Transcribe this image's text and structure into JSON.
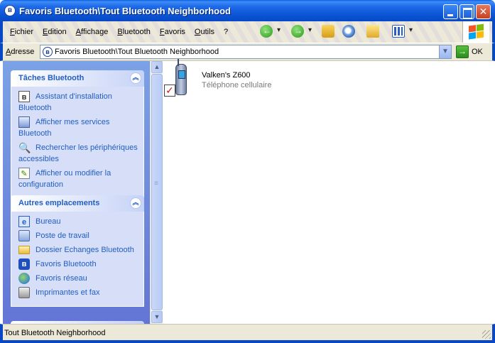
{
  "window": {
    "title": "Favoris Bluetooth\\Tout Bluetooth Neighborhood",
    "app_icon": "bluetooth-icon"
  },
  "menu": {
    "items": [
      "Fichier",
      "Edition",
      "Affichage",
      "Bluetooth",
      "Favoris",
      "Outils",
      "?"
    ]
  },
  "toolbar": {
    "icons": [
      "back-arrow-icon",
      "forward-arrow-icon",
      "up-folder-icon",
      "search-icon",
      "folders-icon",
      "views-icon"
    ]
  },
  "address": {
    "label": "Adresse",
    "value": "Favoris Bluetooth\\Tout Bluetooth Neighborhood",
    "go_label": "OK"
  },
  "tasks_panel": {
    "title": "Tâches Bluetooth",
    "items": [
      {
        "label": "Assistant d'installation Bluetooth",
        "icon": "wizard-icon"
      },
      {
        "label": "Afficher mes services Bluetooth",
        "icon": "services-icon"
      },
      {
        "label": "Rechercher les périphériques accessibles",
        "icon": "search-devices-icon"
      },
      {
        "label": "Afficher ou modifier la configuration",
        "icon": "configuration-icon"
      }
    ]
  },
  "places_panel": {
    "title": "Autres emplacements",
    "items": [
      {
        "label": "Bureau",
        "icon": "desktop-icon"
      },
      {
        "label": "Poste de travail",
        "icon": "my-computer-icon"
      },
      {
        "label": "Dossier Echanges Bluetooth",
        "icon": "folder-icon"
      },
      {
        "label": "Favoris Bluetooth",
        "icon": "bluetooth-icon"
      },
      {
        "label": "Favoris réseau",
        "icon": "network-icon"
      },
      {
        "label": "Imprimantes et fax",
        "icon": "printer-icon"
      }
    ]
  },
  "content": {
    "devices": [
      {
        "name": "Valken's Z600",
        "type": "Téléphone cellulaire",
        "icon": "mobile-phone-icon",
        "checked": true
      }
    ]
  },
  "status": {
    "text": "Tout Bluetooth Neighborhood"
  },
  "colors": {
    "title_bar": "#0a55d6",
    "task_pane": "#7ba2e7",
    "link_text": "#215dc6",
    "check_mark": "#d01010"
  }
}
